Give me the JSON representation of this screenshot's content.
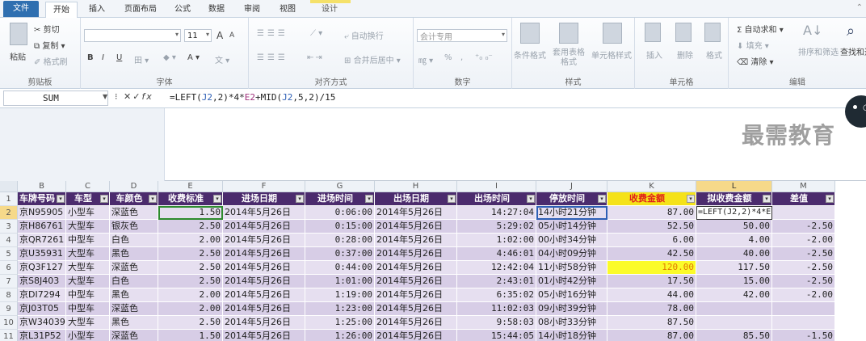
{
  "tabs": [
    "文件",
    "开始",
    "插入",
    "页面布局",
    "公式",
    "数据",
    "审阅",
    "视图",
    "设计"
  ],
  "ribbon": {
    "clipboard": {
      "label": "剪贴板",
      "paste": "粘贴",
      "cut": "剪切",
      "copy": "复制",
      "format_painter": "格式刷"
    },
    "font": {
      "label": "字体",
      "size": "11",
      "bold": "B",
      "italic": "I",
      "underline": "U",
      "grow": "A",
      "shrink": "A"
    },
    "alignment": {
      "label": "对齐方式",
      "wrap": "自动换行",
      "merge": "合并后居中"
    },
    "number": {
      "label": "数字",
      "format": "会计专用",
      "percent": "%"
    },
    "styles": {
      "label": "样式",
      "conditional": "条件格式",
      "table": "套用表格格式",
      "cell_styles": "单元格样式"
    },
    "cells": {
      "label": "单元格",
      "insert": "插入",
      "delete": "删除",
      "format": "格式"
    },
    "editing": {
      "label": "编辑",
      "autosum": "自动求和",
      "fill": "填充",
      "clear": "清除",
      "sort": "排序和筛选",
      "find": "查找和选"
    }
  },
  "formula_bar": {
    "name_box": "SUM",
    "formula_parts": [
      "=LEFT(",
      "J2",
      ",2)*4*",
      "E2",
      "+MID(",
      "J2",
      ",5,2)/15"
    ]
  },
  "columns": [
    "B",
    "C",
    "D",
    "E",
    "F",
    "G",
    "H",
    "I",
    "J",
    "K",
    "L",
    "M"
  ],
  "headers": [
    "车牌号码",
    "车型",
    "车颜色",
    "收费标准",
    "进场日期",
    "进场时间",
    "出场日期",
    "出场时间",
    "停放时间",
    "收费金额",
    "拟收费金额",
    "差值"
  ],
  "rows": [
    {
      "n": "2",
      "cells": [
        "京N95905",
        "小型车",
        "深蓝色",
        "1.50",
        "2014年5月26日",
        "0:06:00",
        "2014年5月26日",
        "14:27:04",
        "14小时21分钟",
        "87.00",
        "=LEFT(J2,2)*4*E2+MID(J2,5,",
        ""
      ]
    },
    {
      "n": "3",
      "cells": [
        "京H86761",
        "大型车",
        "银灰色",
        "2.50",
        "2014年5月26日",
        "0:15:00",
        "2014年5月26日",
        "5:29:02",
        "05小时14分钟",
        "52.50",
        "50.00",
        "-2.50"
      ]
    },
    {
      "n": "4",
      "cells": [
        "京QR7261",
        "中型车",
        "白色",
        "2.00",
        "2014年5月26日",
        "0:28:00",
        "2014年5月26日",
        "1:02:00",
        "00小时34分钟",
        "6.00",
        "4.00",
        "-2.00"
      ]
    },
    {
      "n": "5",
      "cells": [
        "京U35931",
        "大型车",
        "黑色",
        "2.50",
        "2014年5月26日",
        "0:37:00",
        "2014年5月26日",
        "4:46:01",
        "04小时09分钟",
        "42.50",
        "40.00",
        "-2.50"
      ]
    },
    {
      "n": "6",
      "cells": [
        "京Q3F127",
        "大型车",
        "深蓝色",
        "2.50",
        "2014年5月26日",
        "0:44:00",
        "2014年5月26日",
        "12:42:04",
        "11小时58分钟",
        "120.00",
        "117.50",
        "-2.50"
      ]
    },
    {
      "n": "7",
      "cells": [
        "京S8J403",
        "大型车",
        "白色",
        "2.50",
        "2014年5月26日",
        "1:01:00",
        "2014年5月26日",
        "2:43:01",
        "01小时42分钟",
        "17.50",
        "15.00",
        "-2.50"
      ]
    },
    {
      "n": "8",
      "cells": [
        "京DI7294",
        "中型车",
        "黑色",
        "2.00",
        "2014年5月26日",
        "1:19:00",
        "2014年5月26日",
        "6:35:02",
        "05小时16分钟",
        "44.00",
        "42.00",
        "-2.00"
      ]
    },
    {
      "n": "9",
      "cells": [
        "京J03T05",
        "中型车",
        "深蓝色",
        "2.00",
        "2014年5月26日",
        "1:23:00",
        "2014年5月26日",
        "11:02:03",
        "09小时39分钟",
        "78.00",
        "",
        ""
      ]
    },
    {
      "n": "10",
      "cells": [
        "京W34039",
        "大型车",
        "黑色",
        "2.50",
        "2014年5月26日",
        "1:25:00",
        "2014年5月26日",
        "9:58:03",
        "08小时33分钟",
        "87.50",
        "",
        ""
      ]
    },
    {
      "n": "11",
      "cells": [
        "京L31P52",
        "小型车",
        "深蓝色",
        "1.50",
        "2014年5月26日",
        "1:26:00",
        "2014年5月26日",
        "15:44:05",
        "14小时18分钟",
        "87.00",
        "85.50",
        "-1.50"
      ]
    }
  ],
  "watermark": "最需教育"
}
